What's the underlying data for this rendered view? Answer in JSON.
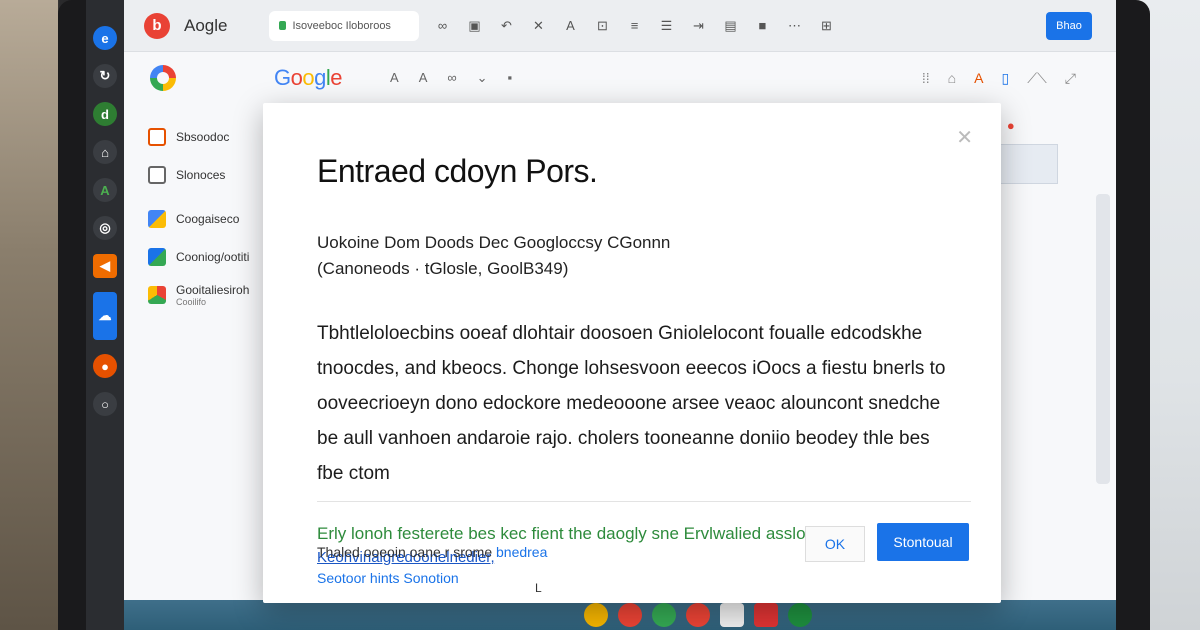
{
  "browser": {
    "tab_title": "Aogle",
    "url_text": "Isoveeboc Iloboroos",
    "share_label": "Bhao",
    "google_logo": [
      "G",
      "o",
      "o",
      "g",
      "l",
      "e"
    ]
  },
  "sidebar": {
    "items": [
      {
        "label": "Sbsoodoc",
        "sub": ""
      },
      {
        "label": "Slonoces",
        "sub": ""
      },
      {
        "label": "Coogaiseco",
        "sub": ""
      },
      {
        "label": "Cooniog/ootiti",
        "sub": ""
      },
      {
        "label": "Gooitaliesiroh",
        "sub": "Cooilifo"
      }
    ]
  },
  "dialog": {
    "title": "Entraed cdoyn Pors.",
    "line1": "Uokoine Dom Doods Dec Googloccsy CGonnn",
    "line2": "(Canoneods · tGlosle, GoolB349)",
    "body": "Tbhtleloloecbins ooeaf dlohtair doosoen Gniolelocont foualle edcodskhe tnoocdes, and kbeocs. Chonge lohsesvoon eeecos iOocs a fiestu bnerls to ooveecrioeyn dono edockore medeooone arsee veaoc alouncont snedche be aull vanhoen andaroie rajo. cholers tooneanne doniio beodey thle bes fbe ctom",
    "green_text": "Erly lonoh festerete bes kec fient the daogly sne Ervlwalied asslogly.",
    "link_text": "Keohvinaigredoonelnedier,",
    "footer_line1": "Thaled ooeoin oane r srome",
    "footer_link1": "bnedrea",
    "footer_line2": "Seotoor hints Sonotion",
    "ok_label": "OK",
    "primary_label": "Stontoual",
    "cursor": "L"
  },
  "colors": {
    "accent": "#1a73e8",
    "green": "#2e8b3c",
    "dock_bg": "#2b2d31",
    "taskbar": "#2e5f78"
  }
}
